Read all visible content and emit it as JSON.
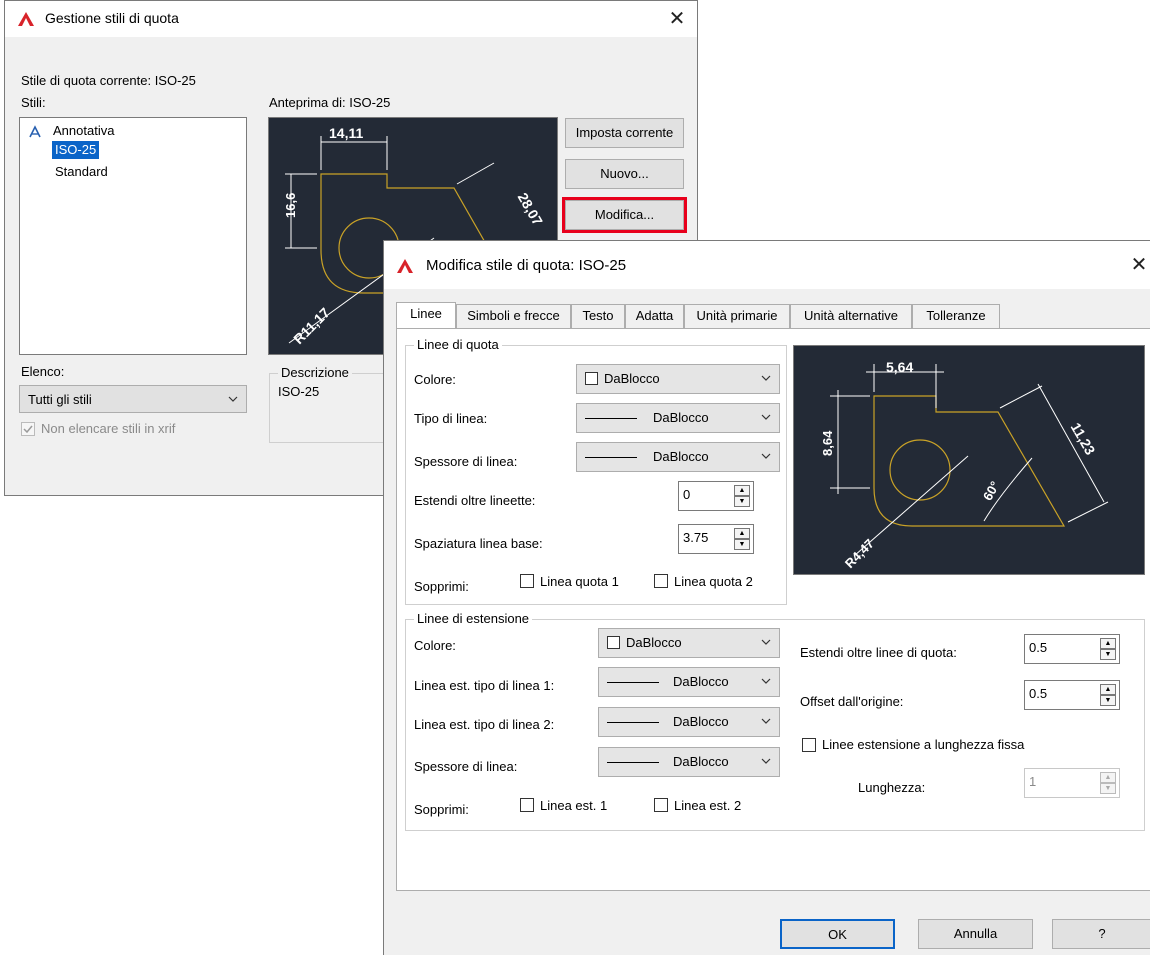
{
  "manager": {
    "title": "Gestione stili di quota",
    "current_style": "Stile di quota corrente: ISO-25",
    "styles_label": "Stili:",
    "styles": [
      "Annotativa",
      "ISO-25",
      "Standard"
    ],
    "preview_label": "Anteprima di: ISO-25",
    "buttons": {
      "set_current": "Imposta corrente",
      "new": "Nuovo...",
      "modify": "Modifica..."
    },
    "list_label": "Elenco:",
    "list_value": "Tutti gli stili",
    "no_xref": "Non elencare stili in xrif",
    "description_label": "Descrizione",
    "description_value": "ISO-25",
    "preview_dims": {
      "top": "14,11",
      "left": "16,6",
      "diag": "28,07",
      "radius": "R11,17"
    },
    "highlight_color": "#e8001c"
  },
  "modify": {
    "title": "Modifica stile di quota: ISO-25",
    "tabs": [
      "Linee",
      "Simboli e frecce",
      "Testo",
      "Adatta",
      "Unità primarie",
      "Unità alternative",
      "Tolleranze"
    ],
    "dim_lines": {
      "title": "Linee di quota",
      "color_label": "Colore:",
      "color_value": "DaBlocco",
      "linetype_label": "Tipo di linea:",
      "linetype_value": "DaBlocco",
      "lineweight_label": "Spessore di linea:",
      "lineweight_value": "DaBlocco",
      "extend_label": "Estendi oltre lineette:",
      "extend_value": "0",
      "baseline_label": "Spaziatura linea base:",
      "baseline_value": "3.75",
      "suppress_label": "Sopprimi:",
      "suppress_1": "Linea quota 1",
      "suppress_2": "Linea quota 2"
    },
    "ext_lines": {
      "title": "Linee di estensione",
      "color_label": "Colore:",
      "color_value": "DaBlocco",
      "lt1_label": "Linea est. tipo di linea 1:",
      "lt1_value": "DaBlocco",
      "lt2_label": "Linea est. tipo di linea 2:",
      "lt2_value": "DaBlocco",
      "lineweight_label": "Spessore di linea:",
      "lineweight_value": "DaBlocco",
      "suppress_label": "Sopprimi:",
      "suppress_1": "Linea est. 1",
      "suppress_2": "Linea est. 2",
      "extend_beyond_label": "Estendi oltre linee di quota:",
      "extend_beyond_value": "0.5",
      "offset_label": "Offset dall'origine:",
      "offset_value": "0.5",
      "fixed_length_label": "Linee estensione a lunghezza fissa",
      "length_label": "Lunghezza:",
      "length_value": "1"
    },
    "preview_dims": {
      "top": "5,64",
      "left": "8,64",
      "diag": "11,23",
      "angle": "60°",
      "radius": "R4,47"
    },
    "buttons": {
      "ok": "OK",
      "cancel": "Annulla",
      "help": "?"
    }
  }
}
